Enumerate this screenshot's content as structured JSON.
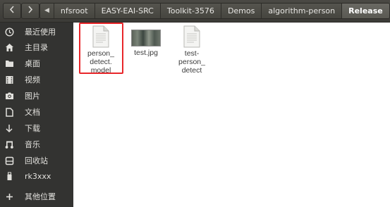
{
  "breadcrumb": {
    "items": [
      "nfsroot",
      "EASY-EAI-SRC",
      "Toolkit-3576",
      "Demos",
      "algorithm-person",
      "Release"
    ]
  },
  "sidebar": {
    "items": [
      {
        "label": "最近使用",
        "icon": "clock-icon"
      },
      {
        "label": "主目录",
        "icon": "home-icon"
      },
      {
        "label": "桌面",
        "icon": "desktop-folder-icon"
      },
      {
        "label": "视频",
        "icon": "video-icon"
      },
      {
        "label": "图片",
        "icon": "camera-icon"
      },
      {
        "label": "文档",
        "icon": "document-icon"
      },
      {
        "label": "下载",
        "icon": "download-icon"
      },
      {
        "label": "音乐",
        "icon": "music-icon"
      },
      {
        "label": "回收站",
        "icon": "trash-icon"
      },
      {
        "label": "rk3xxx",
        "icon": "usb-drive-icon"
      },
      {
        "label": "其他位置",
        "icon": "plus-icon"
      }
    ]
  },
  "files": [
    {
      "name": "person_\ndetect.\nmodel",
      "type": "document",
      "selected": true
    },
    {
      "name": "test.jpg",
      "type": "image"
    },
    {
      "name": "test-\nperson_\ndetect",
      "type": "document"
    }
  ],
  "colors": {
    "highlight": "#e8262a",
    "sidebar_bg": "#333331",
    "topbar_bg": "#3c3b37"
  }
}
